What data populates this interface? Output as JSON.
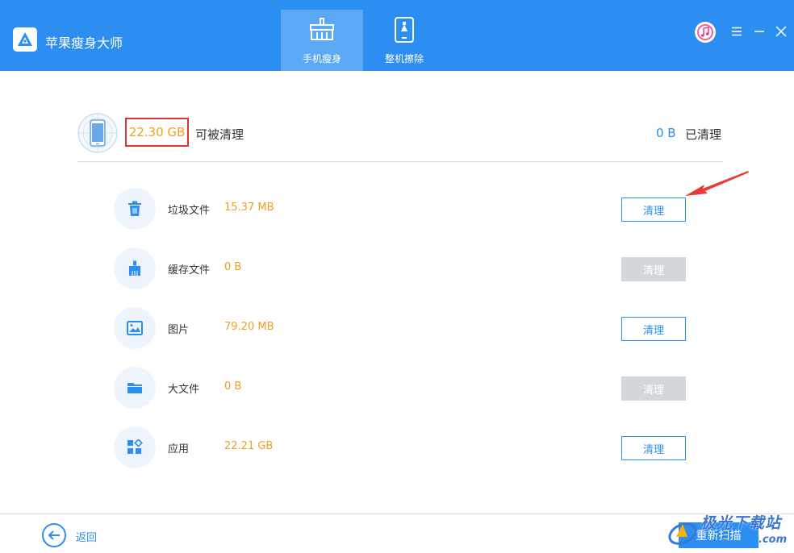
{
  "app": {
    "title": "苹果瘦身大师"
  },
  "tabs": [
    {
      "label": "手机瘦身",
      "active": true
    },
    {
      "label": "整机擦除",
      "active": false
    }
  ],
  "summary": {
    "total_cleanable": "22.30 GB",
    "cleanable_label": "可被清理",
    "cleaned_value": "0 B",
    "cleaned_label": "已清理"
  },
  "items": [
    {
      "name": "垃圾文件",
      "size": "15.37 MB",
      "button": "清理",
      "enabled": true,
      "icon": "trash-icon"
    },
    {
      "name": "缓存文件",
      "size": "0 B",
      "button": "清理",
      "enabled": false,
      "icon": "brush-icon"
    },
    {
      "name": "图片",
      "size": "79.20 MB",
      "button": "清理",
      "enabled": true,
      "icon": "image-icon"
    },
    {
      "name": "大文件",
      "size": "0 B",
      "button": "清理",
      "enabled": false,
      "icon": "folder-icon"
    },
    {
      "name": "应用",
      "size": "22.21 GB",
      "button": "清理",
      "enabled": true,
      "icon": "apps-icon"
    }
  ],
  "footer": {
    "back_label": "返回",
    "rescan_label": "重新扫描"
  },
  "watermark": {
    "text": "极光下载站",
    "sub": ".com"
  },
  "colors": {
    "primary": "#2b8ef0",
    "size_text": "#f0a020",
    "highlight_box": "#e03232",
    "disabled": "#d3d6da"
  }
}
